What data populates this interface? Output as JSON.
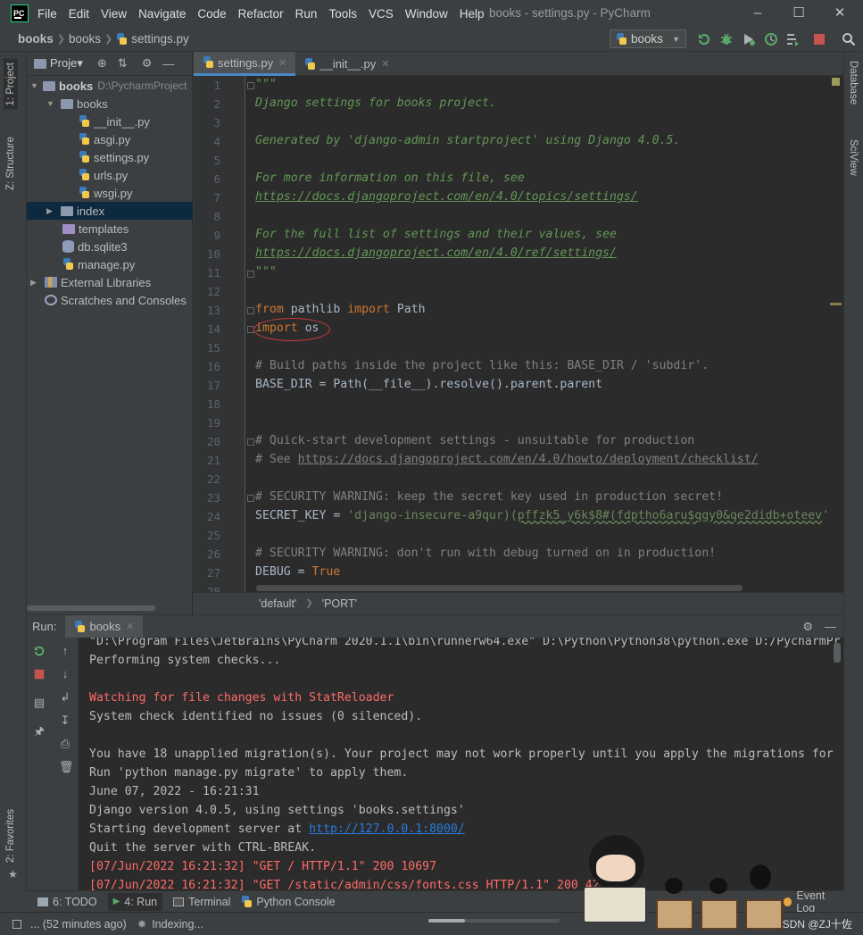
{
  "window": {
    "title": "books - settings.py - PyCharm",
    "logo_text": "PC",
    "menu": [
      "File",
      "Edit",
      "View",
      "Navigate",
      "Code",
      "Refactor",
      "Run",
      "Tools",
      "VCS",
      "Window",
      "Help"
    ]
  },
  "navbar": {
    "crumbs": [
      "books",
      "books",
      "settings.py"
    ],
    "run_config": "books"
  },
  "left_stripe": {
    "project_tab": "1: Project",
    "structure_tab": "Z: Structure",
    "favorites_tab": "2: Favorites"
  },
  "right_stripe": {
    "database_tab": "Database",
    "sciview_tab": "SciView"
  },
  "project_panel": {
    "title": "Proje▾",
    "tree": [
      {
        "label": "books",
        "extra": "D:\\PycharmProject",
        "type": "folder",
        "bold": true
      },
      {
        "label": "books",
        "type": "folder"
      },
      {
        "label": "__init__.py",
        "type": "py"
      },
      {
        "label": "asgi.py",
        "type": "py"
      },
      {
        "label": "settings.py",
        "type": "py"
      },
      {
        "label": "urls.py",
        "type": "py"
      },
      {
        "label": "wsgi.py",
        "type": "py"
      },
      {
        "label": "index",
        "type": "folder"
      },
      {
        "label": "templates",
        "type": "folder"
      },
      {
        "label": "db.sqlite3",
        "type": "db"
      },
      {
        "label": "manage.py",
        "type": "py"
      },
      {
        "label": "External Libraries",
        "type": "lib"
      },
      {
        "label": "Scratches and Consoles",
        "type": "scratch"
      }
    ]
  },
  "editor_tabs": [
    {
      "label": "settings.py",
      "active": true
    },
    {
      "label": "__init__.py",
      "active": false
    }
  ],
  "editor": {
    "line_numbers": [
      "1",
      "2",
      "3",
      "4",
      "5",
      "6",
      "7",
      "8",
      "9",
      "10",
      "11",
      "12",
      "13",
      "14",
      "15",
      "16",
      "17",
      "18",
      "19",
      "20",
      "21",
      "22",
      "23",
      "24",
      "25",
      "26",
      "27",
      "28"
    ],
    "lines": {
      "l1": "\"\"\"",
      "l2": "Django settings for books project.",
      "l4": "Generated by 'django-admin startproject' using Django 4.0.5.",
      "l6": "For more information on this file, see",
      "l7": "https://docs.djangoproject.com/en/4.0/topics/settings/",
      "l9": "For the full list of settings and their values, see",
      "l10": "https://docs.djangoproject.com/en/4.0/ref/settings/",
      "l11": "\"\"\"",
      "l13_kw1": "from",
      "l13_mod": " pathlib ",
      "l13_kw2": "import",
      "l13_name": " Path",
      "l14_kw": "import",
      "l14_name": " os",
      "l16": "# Build paths inside the project like this: BASE_DIR / 'subdir'.",
      "l17": "BASE_DIR = Path(__file__).resolve().parent.parent",
      "l20": "# Quick-start development settings - unsuitable for production",
      "l21_pre": "# See ",
      "l21_link": "https://docs.djangoproject.com/en/4.0/howto/deployment/checklist/",
      "l23": "# SECURITY WARNING: keep the secret key used in production secret!",
      "l24_var": "SECRET_KEY = ",
      "l24_str1": "'django-insecure-a9qur)(",
      "l24_str2": "pffzk5_y6k$8#(fdptho6aru$qgy0&qe2didb+oteev",
      "l24_str3": "'",
      "l26": "# SECURITY WARNING: don't run with debug turned on in production!",
      "l27_var": "DEBUG = ",
      "l27_kw": "True"
    },
    "breadcrumbs": [
      "'default'",
      "'PORT'"
    ]
  },
  "run_panel": {
    "label": "Run:",
    "tab": "books",
    "console": {
      "c1": "\"D:\\Program Files\\JetBrains\\PyCharm 2020.1.1\\bin\\runnerw64.exe\" D:\\Python\\Python38\\python.exe D:/PycharmPr",
      "c2": "Performing system checks...",
      "c4": "Watching for file changes with StatReloader",
      "c5": "System check identified no issues (0 silenced).",
      "c7": "You have 18 unapplied migration(s). Your project may not work properly until you apply the migrations for",
      "c8": "Run 'python manage.py migrate' to apply them.",
      "c9": "June 07, 2022 - 16:21:31",
      "c10": "Django version 4.0.5, using settings 'books.settings'",
      "c11_pre": "Starting development server at ",
      "c11_link": "http://127.0.0.1:8000/",
      "c12": "Quit the server with CTRL-BREAK.",
      "c13": "[07/Jun/2022 16:21:32] \"GET / HTTP/1.1\" 200 10697",
      "c14": "[07/Jun/2022 16:21:32] \"GET /static/admin/css/fonts.css HTTP/1.1\" 200 423"
    }
  },
  "bottom_tabs": {
    "todo": "6: TODO",
    "run": "4: Run",
    "terminal": "Terminal",
    "python_console": "Python Console",
    "event_log": "Event Log"
  },
  "statusbar": {
    "left": "... (52 minutes ago)",
    "indexing": "Indexing...",
    "watermark": "CSDN @ZJ十佐"
  },
  "colors": {
    "accent": "#4a88c7",
    "error_red": "#ff6b68",
    "docstring": "#629755",
    "keyword": "#cc7832"
  }
}
